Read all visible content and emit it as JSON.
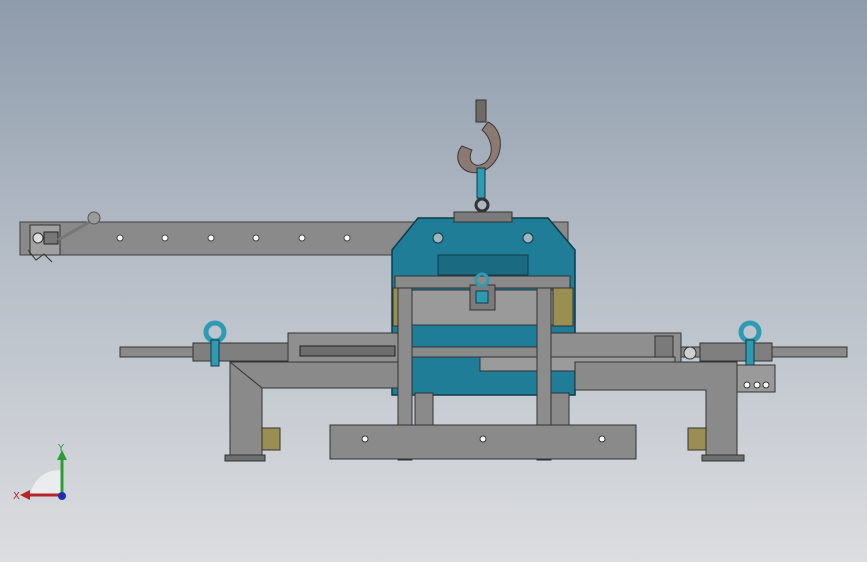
{
  "window": {
    "title": "",
    "background": "gradient-gray-blue"
  },
  "model": {
    "name": "",
    "colors": {
      "steel": "#8a8a8a",
      "steel_dark": "#5e5e5e",
      "frame_blue": "#1f7d97",
      "teal": "#2f9bb3",
      "hook": "#8a7a72",
      "brass": "#9a8f52"
    },
    "parts": [
      "lifting-hook",
      "boom-arm",
      "main-frame",
      "crossbar",
      "cylinder-left",
      "cylinder-right",
      "leg-left",
      "leg-right",
      "base-plate",
      "eye-bolt-left",
      "eye-bolt-right"
    ]
  },
  "triad": {
    "x_label": "X",
    "y_label": "Y",
    "x_color": "#b3262a",
    "y_color": "#2e9b3a",
    "z_color": "#1d2fb0"
  }
}
